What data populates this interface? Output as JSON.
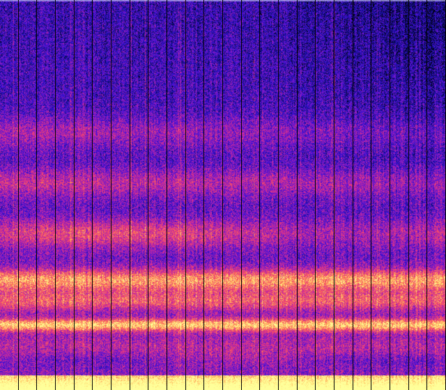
{
  "image": {
    "kind": "spectrogram",
    "colormap": [
      "#000010",
      "#10108a",
      "#3a10d8",
      "#7a18c8",
      "#c62aa0",
      "#ee3c74",
      "#ff7a52",
      "#ffd26a",
      "#ffff9a"
    ],
    "divider_color": "#000000",
    "top_edge_color": "#d0d0ff",
    "segment_count": 24,
    "bands": [
      {
        "name": "band-low-strong",
        "level": 0.98
      },
      {
        "name": "band-lower-mid",
        "level": 0.92
      },
      {
        "name": "band-mid",
        "level": 0.6
      },
      {
        "name": "band-upper-mid",
        "level": 0.45
      },
      {
        "name": "band-high",
        "level": 0.35
      }
    ]
  }
}
